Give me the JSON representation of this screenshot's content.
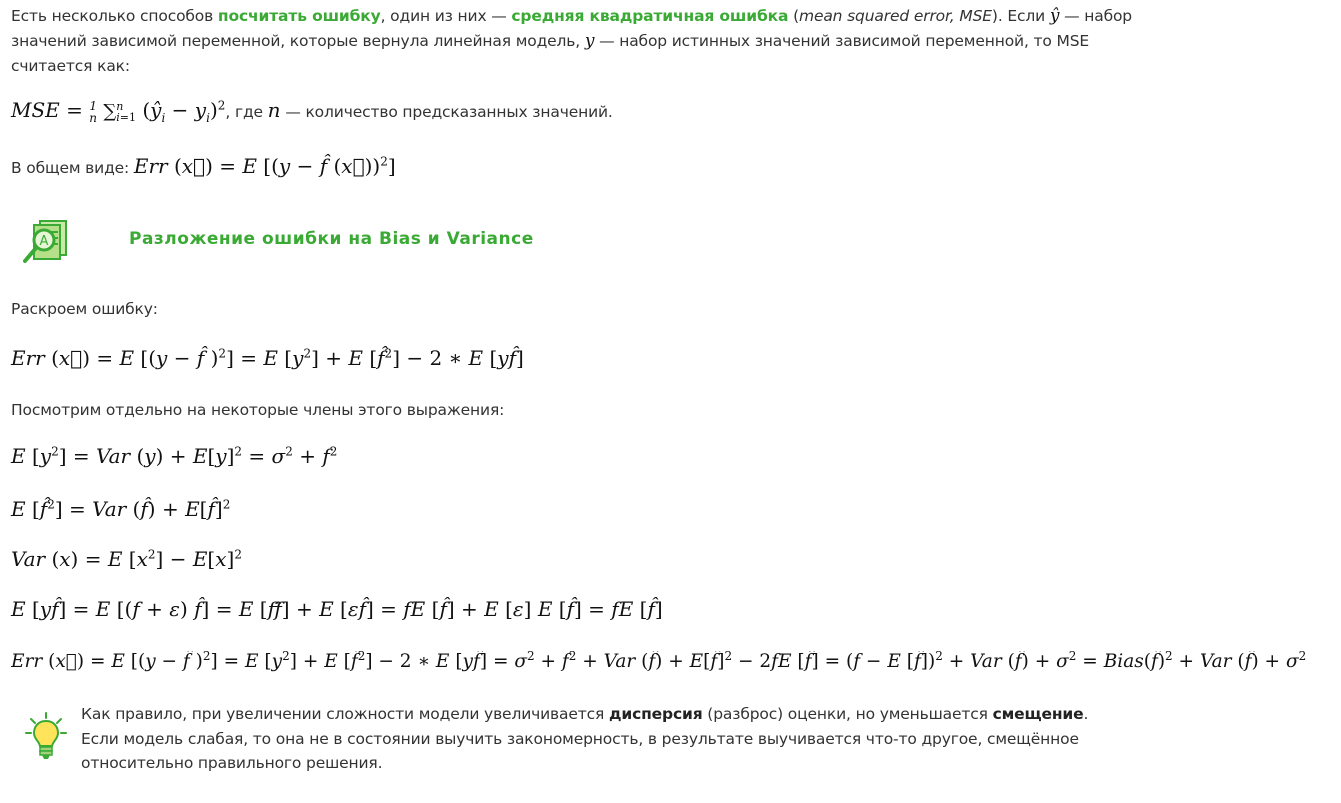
{
  "intro": {
    "t1": "Есть несколько способов ",
    "link1": "посчитать ошибку",
    "t2": ", один из них — ",
    "link2": "средняя квадратичная ошибка",
    "t3": " (",
    "t3i": "mean squared error, MSE",
    "t4": "). Если ",
    "t5": " —  набор",
    "line2a": "значений зависимой переменной, которые вернула линейная модель, ",
    "line2b": " — набор истинных значений зависимой переменной, то MSE",
    "line3": "считается как:"
  },
  "mse_tail": ", где ",
  "mse_tail2": " — количество предсказанных значений.",
  "general_prefix": "В общем виде: ",
  "heading": "Разложение ошибки на Bias и Variance",
  "expand": "Раскроем ошибку:",
  "look": "Посмотрим отдельно на некоторые члены этого выражения:",
  "tip": {
    "t1": "Как правило, при увеличении сложности модели увеличивается ",
    "b1": "дисперсия",
    "t2": " (разброс) оценки, но уменьшается ",
    "b2": "смещение",
    "t3": ". Если модель слабая, то она не в состоянии выучить закономерность, в результате выучивается что-то другое, смещённое относительно правильного решения."
  },
  "colors": {
    "accent": "#3aaa35",
    "text": "#333333"
  },
  "icons": [
    "book-magnifier-icon",
    "lightbulb-icon"
  ]
}
